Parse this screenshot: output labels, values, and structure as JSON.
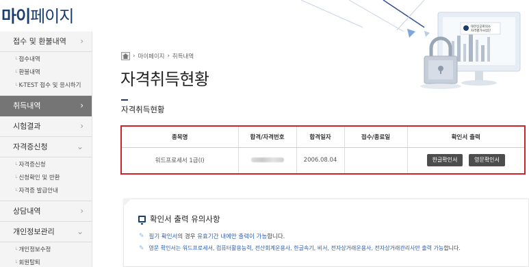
{
  "header": {
    "site_title_bold": "마이",
    "site_title_rest": "페이지"
  },
  "hero": {
    "sign_line1": "대한상공회의소",
    "sign_line2": "자격평가사업단"
  },
  "sidebar": {
    "items": [
      {
        "label": "접수 및 환불내역",
        "chevron": "›",
        "sub": [
          "접수내역",
          "환불내역",
          "K-TEST 접수 및 응시하기"
        ]
      },
      {
        "label": "취득내역",
        "chevron": "›",
        "active": true
      },
      {
        "label": "시험결과",
        "chevron": "›"
      },
      {
        "label": "자격증신청",
        "chevron": "⌄",
        "sub": [
          "자격증신청",
          "신청확인 및 반환",
          "자격증 발급안내"
        ]
      },
      {
        "label": "상담내역",
        "chevron": "›"
      },
      {
        "label": "개인정보관리",
        "chevron": "⌄",
        "sub": [
          "개인정보수정",
          "회원탈퇴"
        ]
      }
    ]
  },
  "breadcrumb": {
    "home_icon": "home-icon",
    "level1": "마이페이지",
    "separator": "›",
    "level2": "취득내역"
  },
  "main": {
    "page_title": "자격취득현황",
    "section_title": "자격취득현황"
  },
  "table": {
    "headers": [
      "종목명",
      "합격/자격번호",
      "합격일자",
      "접수/종료일",
      "확인서 출력"
    ],
    "rows": [
      {
        "name": "워드프로세서 1급(I)",
        "date": "2006.08.04",
        "period": "",
        "btn_kr": "한글확인서",
        "btn_en": "영문확인서"
      }
    ]
  },
  "notice": {
    "title": "확인서 출력 유의사항",
    "line1_a": "필기 확인서",
    "line1_b": "의 경우 ",
    "line1_c": "유효기간 내에만 출력이 가능",
    "line1_d": "합니다.",
    "line2_a": "영문 확인서는 워드프로세서, 컴퓨터활용능력, 전산회계운용사, 한글속기, 비서, 전자상거래운용사, 전자상거래관리사만 출력 가능",
    "line2_b": "합니다."
  },
  "colors": {
    "accent_red": "#d0202a",
    "navy": "#1a3c6e",
    "sidebar_active": "#757575",
    "button": "#4d4d4d",
    "link_blue": "#2a5bb8"
  }
}
